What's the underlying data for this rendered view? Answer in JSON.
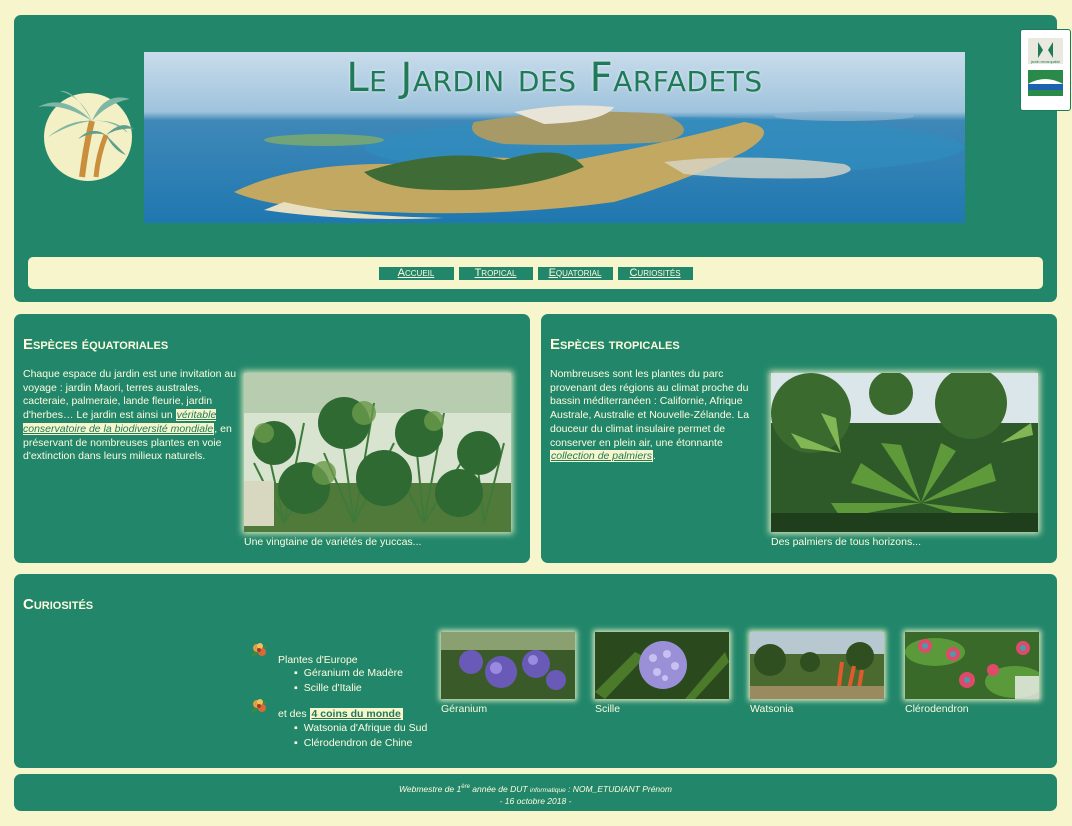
{
  "header": {
    "title": "Le Jardin des Farfadets",
    "nav": [
      "Accueil",
      "Tropical",
      "Equatorial",
      "Curiosités"
    ]
  },
  "badge": {
    "label": "jardin remarquable"
  },
  "equatorial": {
    "title": "Espèces équatoriales",
    "text_before": "Chaque espace du jardin est une invitation au voyage : jardin Maori, terres australes, cacteraie, palmeraie, lande fleurie, jardin d'herbes… Le jardin est ainsi un ",
    "link": "véritable conservatoire de la biodiversité mondiale",
    "text_after": ", en préservant de nombreuses plantes en voie d'extinction dans leurs milieux naturels.",
    "caption": "Une vingtaine de variétés de yuccas..."
  },
  "tropical": {
    "title": "Espèces tropicales",
    "text_before": "Nombreuses sont les plantes du parc provenant des régions au climat proche du bassin méditerranéen : Californie, Afrique Australe, Australie et Nouvelle-Zélande. La douceur du climat insulaire permet de conserver en plein air, une étonnante ",
    "link": "collection de palmiers",
    "text_after": ".",
    "caption": "Des palmiers de tous horizons..."
  },
  "curiosities": {
    "title": "Curiosités",
    "group1_label": "Plantes d'Europe",
    "group1_items": [
      "Géranium de Madère",
      "Scille d'Italie"
    ],
    "group2_prefix": "et des ",
    "group2_link": "4 coins du monde",
    "group2_items": [
      "Watsonia d'Afrique du Sud",
      "Clérodendron de Chine"
    ],
    "thumbs": [
      "Géranium",
      "Scille",
      "Watsonia",
      "Clérodendron"
    ]
  },
  "footer": {
    "line1_a": "Webmestre de 1",
    "line1_sup": "ère",
    "line1_b": " année de DUT ",
    "line1_small": "informatique",
    "line1_c": " : NOM_ETUDIANT Prénom",
    "line2": "- 16 octobre 2018 -"
  },
  "colors": {
    "panel": "#22876a",
    "background": "#f6f5cc",
    "text": "#fffbe0",
    "accent": "#1f7a58"
  }
}
